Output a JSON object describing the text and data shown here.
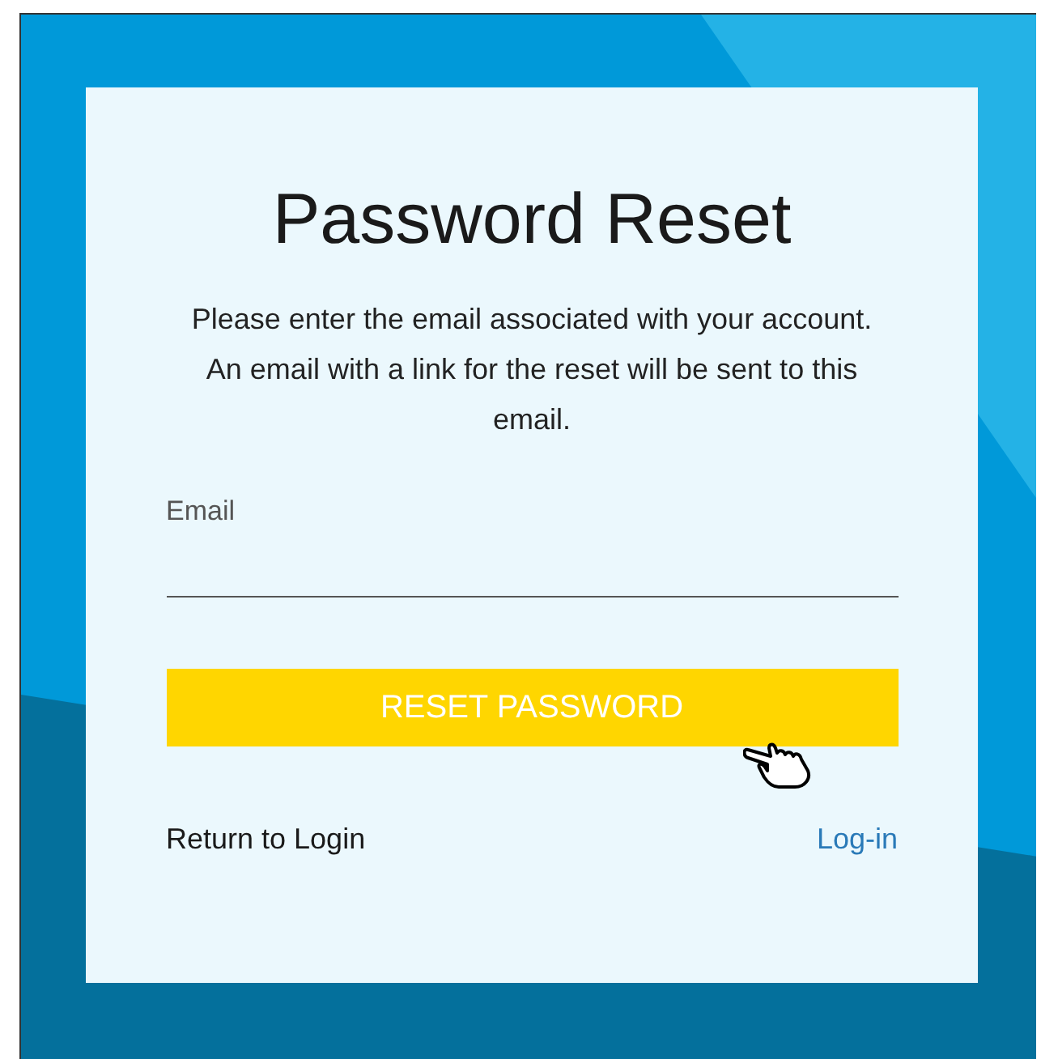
{
  "title": "Password Reset",
  "description": "Please enter the email associated with your account. An email with a link for the reset will be sent to this email.",
  "email_field": {
    "label": "Email"
  },
  "reset_button": {
    "label": "RESET PASSWORD"
  },
  "footer": {
    "text": "Return to Login",
    "link": "Log-in"
  }
}
